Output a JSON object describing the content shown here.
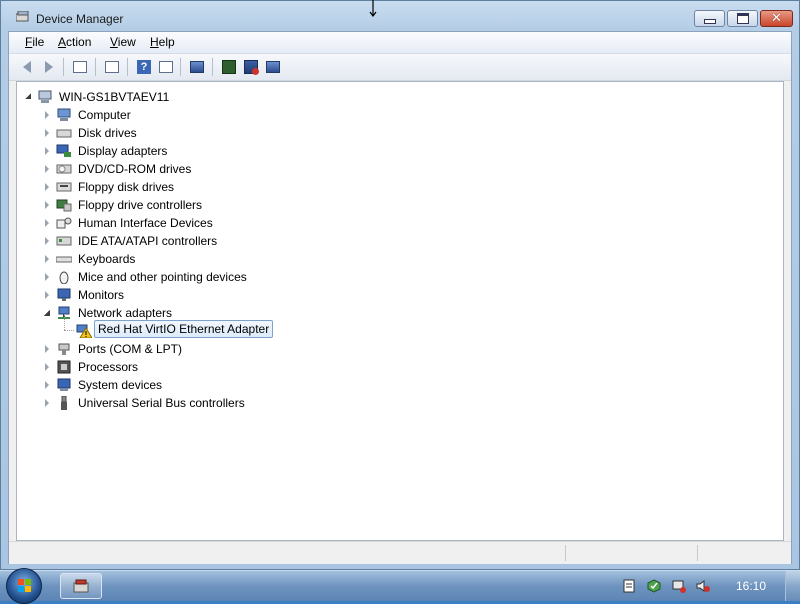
{
  "window": {
    "title": "Device Manager",
    "controls": {
      "minimize_icon": "minimize-icon",
      "maximize_icon": "maximize-icon",
      "close_icon": "close-icon"
    }
  },
  "menubar": {
    "items": [
      {
        "label": "File",
        "accel": "F",
        "rest": "ile"
      },
      {
        "label": "Action",
        "accel": "A",
        "rest": "ction"
      },
      {
        "label": "View",
        "accel": "V",
        "rest": "iew"
      },
      {
        "label": "Help",
        "accel": "H",
        "rest": "elp"
      }
    ]
  },
  "toolbar": {
    "buttons": [
      "back-arrow-icon",
      "forward-arrow-icon",
      "show-hide-console-tree-icon",
      "properties-icon",
      "help-icon",
      "show-action-pane-icon",
      "scan-hardware-icon",
      "update-driver-icon",
      "uninstall-icon",
      "disable-icon"
    ]
  },
  "tree": {
    "root": "WIN-GS1BVTAEV11",
    "categories": [
      {
        "label": "Computer",
        "icon": "computer-icon",
        "expanded": false
      },
      {
        "label": "Disk drives",
        "icon": "disk-drive-icon",
        "expanded": false
      },
      {
        "label": "Display adapters",
        "icon": "display-adapter-icon",
        "expanded": false
      },
      {
        "label": "DVD/CD-ROM drives",
        "icon": "dvd-drive-icon",
        "expanded": false
      },
      {
        "label": "Floppy disk drives",
        "icon": "floppy-disk-icon",
        "expanded": false
      },
      {
        "label": "Floppy drive controllers",
        "icon": "floppy-controller-icon",
        "expanded": false
      },
      {
        "label": "Human Interface Devices",
        "icon": "hid-icon",
        "expanded": false
      },
      {
        "label": "IDE ATA/ATAPI controllers",
        "icon": "ide-controller-icon",
        "expanded": false
      },
      {
        "label": "Keyboards",
        "icon": "keyboard-icon",
        "expanded": false
      },
      {
        "label": "Mice and other pointing devices",
        "icon": "mouse-icon",
        "expanded": false
      },
      {
        "label": "Monitors",
        "icon": "monitor-icon",
        "expanded": false
      },
      {
        "label": "Network adapters",
        "icon": "network-adapter-icon",
        "expanded": true
      },
      {
        "label": "Ports (COM & LPT)",
        "icon": "port-icon",
        "expanded": false
      },
      {
        "label": "Processors",
        "icon": "processor-icon",
        "expanded": false
      },
      {
        "label": "System devices",
        "icon": "system-device-icon",
        "expanded": false
      },
      {
        "label": "Universal Serial Bus controllers",
        "icon": "usb-icon",
        "expanded": false
      }
    ],
    "child": {
      "label": "Red Hat VirtIO Ethernet Adapter",
      "icon": "network-adapter-warning-icon",
      "parent": "Network adapters",
      "selected": true
    }
  },
  "taskbar": {
    "start": "windows-start-icon",
    "app": "device-manager-taskbar-icon",
    "tray": [
      "action-center-icon",
      "network-icon",
      "network-warning-icon",
      "volume-muted-icon"
    ],
    "clock": "16:10"
  },
  "colors": {
    "title_bar": "#b9d1ea",
    "selection": "#dcebfc",
    "taskbar": "#6e93bf",
    "close_button": "#c8452c"
  }
}
